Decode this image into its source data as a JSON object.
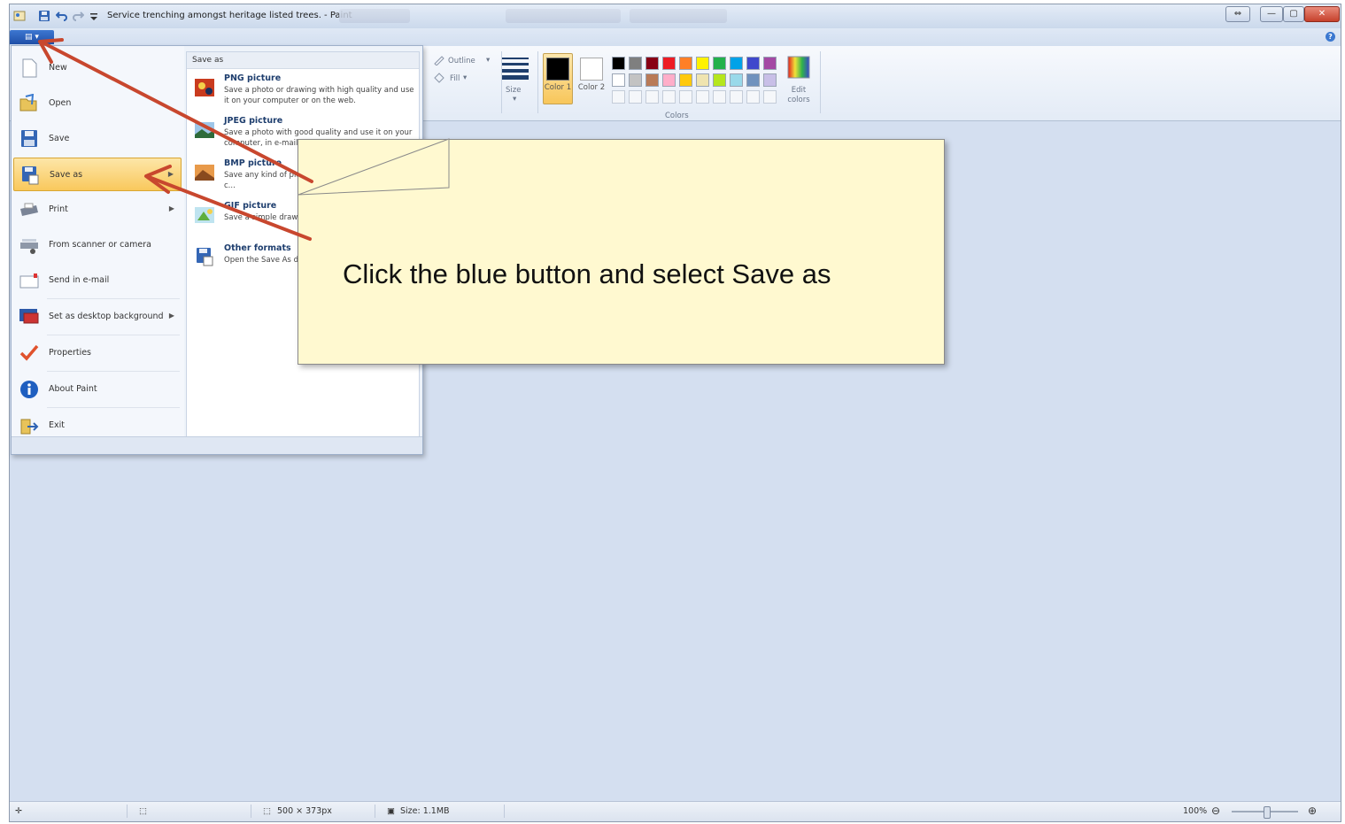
{
  "window": {
    "title": "Service trenching amongst heritage listed trees. - Paint",
    "controls": [
      "⇔",
      "—",
      "▢",
      "✕"
    ]
  },
  "ribbon": {
    "app_button_label": "▤ ▾",
    "shapes": {
      "outline_label": "Outline",
      "fill_label": "Fill"
    },
    "size_label": "Size",
    "color1_label": "Color 1",
    "color2_label": "Color 2",
    "colors_group_label": "Colors",
    "edit_colors_label": "Edit colors",
    "palette_row1": [
      "#000000",
      "#7f7f7f",
      "#880015",
      "#ed1c24",
      "#ff7f27",
      "#fff200",
      "#22b14c",
      "#00a2e8",
      "#3f48cc",
      "#a349a4"
    ],
    "palette_row2": [
      "#ffffff",
      "#c3c3c3",
      "#b97a57",
      "#ffaec9",
      "#ffc90e",
      "#efe4b0",
      "#b5e61d",
      "#99d9ea",
      "#7092be",
      "#c8bfe7"
    ],
    "color1": "#000000",
    "color2": "#ffffff"
  },
  "file_menu": {
    "items": [
      {
        "label": "New",
        "icon": "new-file-icon"
      },
      {
        "label": "Open",
        "icon": "open-folder-icon"
      },
      {
        "label": "Save",
        "icon": "save-disk-icon"
      },
      {
        "label": "Save as",
        "icon": "save-as-icon"
      },
      {
        "label": "Print",
        "icon": "printer-icon"
      },
      {
        "label": "From scanner or camera",
        "icon": "scanner-icon"
      },
      {
        "label": "Send in e-mail",
        "icon": "email-icon"
      },
      {
        "label": "Set as desktop background",
        "icon": "desktop-background-icon"
      },
      {
        "label": "Properties",
        "icon": "checkmark-icon"
      },
      {
        "label": "About Paint",
        "icon": "info-icon"
      },
      {
        "label": "Exit",
        "icon": "exit-icon"
      }
    ],
    "save_as_header": "Save as",
    "formats": [
      {
        "title": "PNG picture",
        "desc": "Save a photo or drawing with high quality and use it on your computer or on the web."
      },
      {
        "title": "JPEG picture",
        "desc": "Save a photo with good quality and use it on your computer, in e-mail, or on the web."
      },
      {
        "title": "BMP picture",
        "desc": "Save any kind of picture with ... and use it on your c..."
      },
      {
        "title": "GIF picture",
        "desc": "Save a simple drawing ... and use it in e..."
      },
      {
        "title": "Other formats",
        "desc": "Open the Save As d... all possible file typ..."
      }
    ]
  },
  "callout": {
    "text": "Click the blue button and select Save as"
  },
  "statusbar": {
    "dimensions": "500 × 373px",
    "size": "Size: 1.1MB",
    "zoom": "100%"
  },
  "colors": {
    "arrow": "#c8472e",
    "callout_bg": "#fff9d0",
    "highlight": "#f9c85c",
    "app_button": "#2a5db8"
  }
}
